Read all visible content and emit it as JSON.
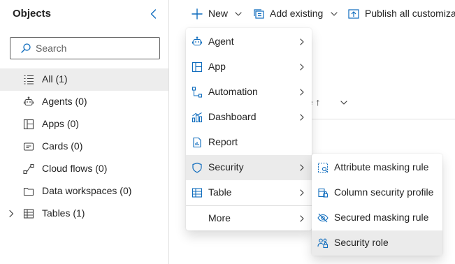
{
  "sidebar": {
    "title": "Objects",
    "collapse_icon": "chevron-left-icon",
    "search": {
      "placeholder": "Search",
      "value": ""
    },
    "items": [
      {
        "label": "All",
        "count": "(1)",
        "icon": "list-icon",
        "selected": true
      },
      {
        "label": "Agents",
        "count": "(0)",
        "icon": "bot-icon"
      },
      {
        "label": "Apps",
        "count": "(0)",
        "icon": "app-icon"
      },
      {
        "label": "Cards",
        "count": "(0)",
        "icon": "card-icon"
      },
      {
        "label": "Cloud flows",
        "count": "(0)",
        "icon": "flow-icon"
      },
      {
        "label": "Data workspaces",
        "count": "(0)",
        "icon": "folder-icon"
      },
      {
        "label": "Tables",
        "count": "(1)",
        "icon": "table-icon",
        "expandable": true
      }
    ]
  },
  "toolbar": {
    "new_label": "New",
    "add_existing_label": "Add existing",
    "publish_label": "Publish all customiza"
  },
  "grid": {
    "sort_header": "me ↑"
  },
  "new_menu": {
    "items": [
      {
        "label": "Agent",
        "icon": "bot-icon",
        "submenu": true
      },
      {
        "label": "App",
        "icon": "app-icon",
        "submenu": true
      },
      {
        "label": "Automation",
        "icon": "flow-icon",
        "submenu": true
      },
      {
        "label": "Dashboard",
        "icon": "dashboard-icon",
        "submenu": true
      },
      {
        "label": "Report",
        "icon": "report-icon",
        "submenu": false
      },
      {
        "label": "Security",
        "icon": "shield-icon",
        "submenu": true,
        "hovered": true
      },
      {
        "label": "Table",
        "icon": "table-icon",
        "submenu": true
      },
      {
        "label": "More",
        "icon": "",
        "submenu": true
      }
    ]
  },
  "security_submenu": {
    "items": [
      {
        "label": "Attribute masking rule",
        "icon": "attribute-masking-icon"
      },
      {
        "label": "Column security profile",
        "icon": "column-security-icon"
      },
      {
        "label": "Secured masking rule",
        "icon": "eye-off-icon"
      },
      {
        "label": "Security role",
        "icon": "people-lock-icon",
        "hovered": true
      }
    ]
  },
  "colors": {
    "accent": "#0f6cbd",
    "hover": "#ebebeb",
    "selected": "#ededed"
  }
}
